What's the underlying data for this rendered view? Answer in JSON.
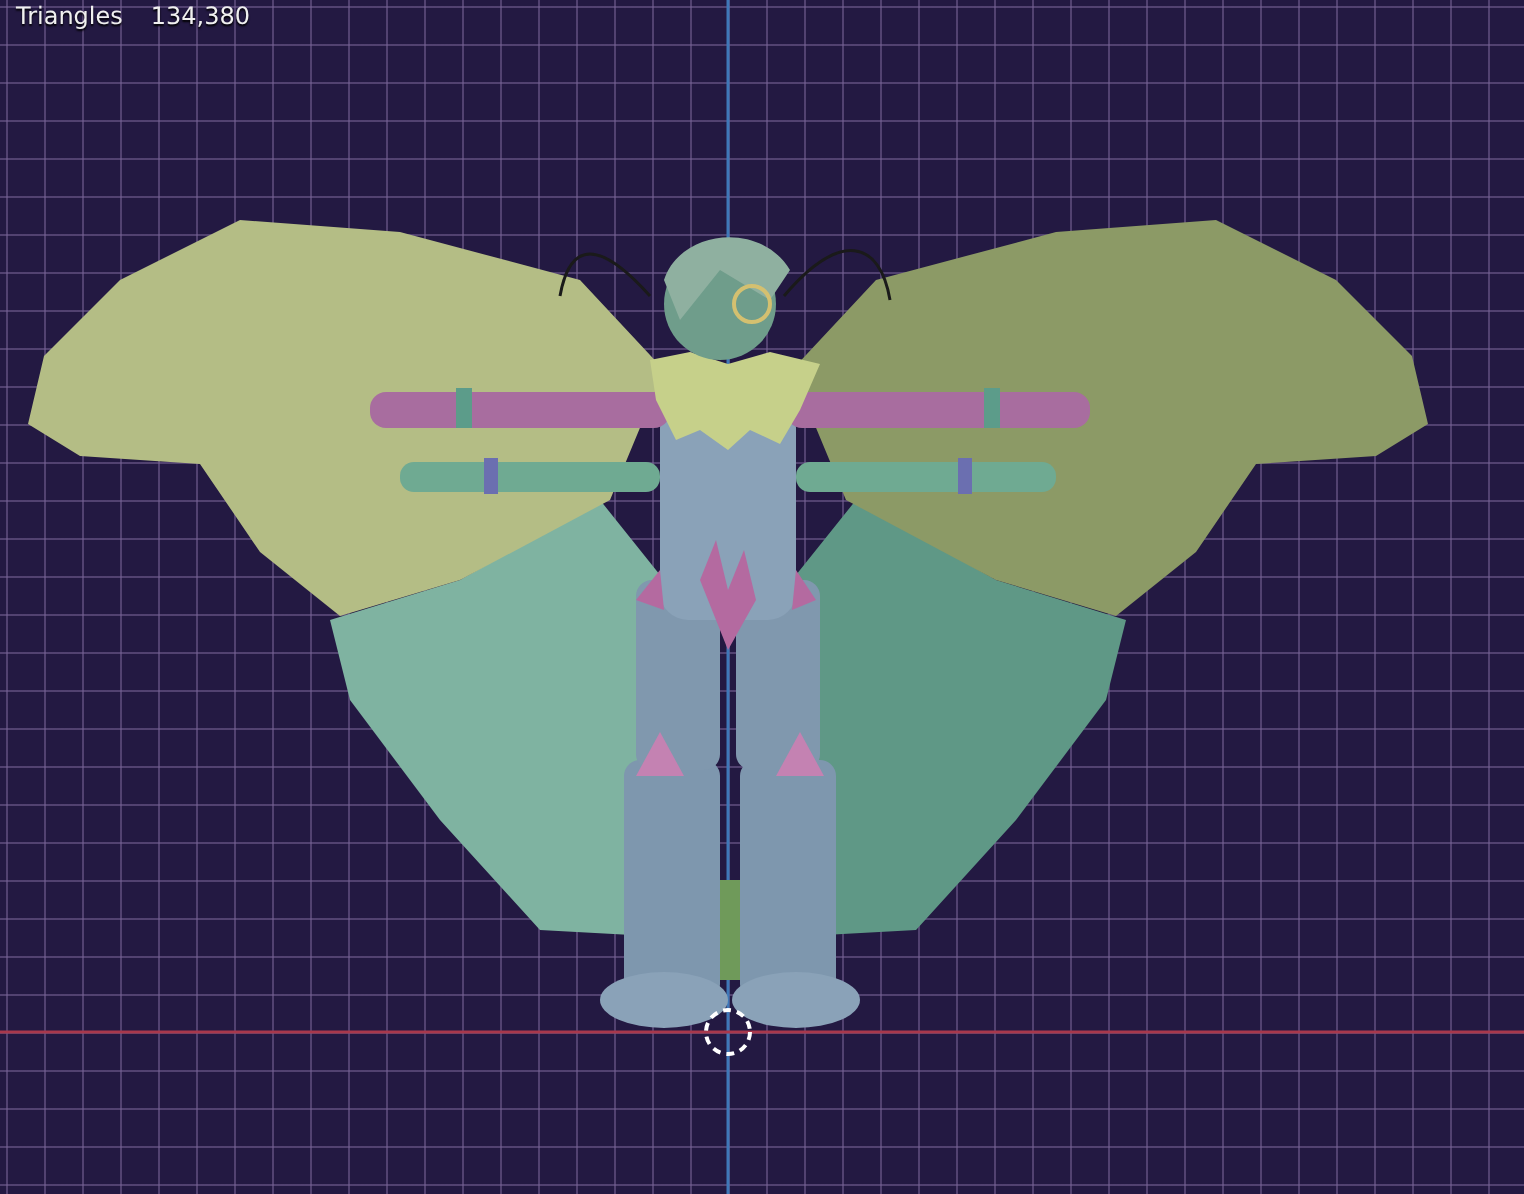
{
  "viewport": {
    "stats": [
      {
        "label": "Triangles",
        "value": "134,380"
      }
    ]
  }
}
